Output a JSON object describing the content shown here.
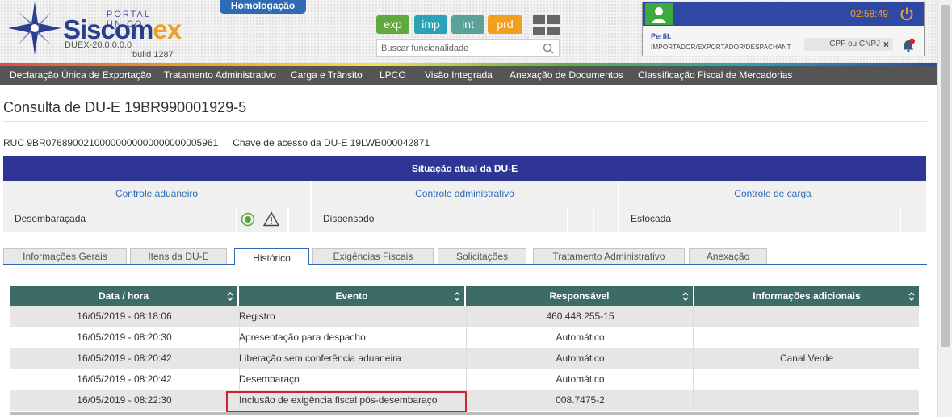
{
  "header": {
    "portal_label": "PORTAL ÚNICO",
    "brand_main": "Siscom",
    "brand_accent": "ex",
    "version": "DUEX-20.0.0.0.0",
    "build": "build 1287",
    "environment_badge": "Homologação",
    "modules": [
      "exp",
      "imp",
      "int",
      "prd"
    ],
    "search_placeholder": "Buscar funcionalidade",
    "clock": "02:58:49",
    "perfil_label": "Perfil:",
    "perfil_value": "IMPORTADOR/EXPORTADOR/DESPACHANT",
    "cpf_placeholder": "CPF ou CNPJ",
    "cpf_clear": "×",
    "icons": [
      "star-logo-icon",
      "apps-grid-icon",
      "search-icon",
      "user-avatar-icon",
      "power-icon",
      "bell-icon"
    ],
    "colors": {
      "brand_blue": "#2e49a3",
      "brand_orange": "#f0a020",
      "exp": "#61a83f",
      "imp": "#2aa3b8",
      "int": "#5aa19a",
      "prd": "#f0a01e"
    }
  },
  "nav": {
    "items": [
      "Declaração Única de Exportação",
      "Tratamento Administrativo",
      "Carga e Trânsito",
      "LPCO",
      "Visão Integrada",
      "Anexação de Documentos",
      "Classificação Fiscal de Mercadorias"
    ]
  },
  "page": {
    "title": "Consulta de DU-E 19BR990001929-5",
    "ruc": "RUC 9BR07689002100000000000000000005961",
    "chave": "Chave de acesso da DU-E 19LWB000042871"
  },
  "situacao": {
    "title": "Situação atual da DU-E",
    "controls": [
      "Controle aduaneiro",
      "Controle administrativo",
      "Controle de carga"
    ],
    "values": [
      "Desembaraçada",
      "Dispensado",
      "Estocada"
    ],
    "status_icons": [
      "check-circle-icon",
      "warning-icon"
    ]
  },
  "tabs": {
    "items": [
      "Informações Gerais",
      "Itens da DU-E",
      "Histórico",
      "Exigências Fiscais",
      "Solicitações",
      "Tratamento Administrativo",
      "Anexação"
    ],
    "active": "Histórico"
  },
  "table": {
    "columns": [
      "Data / hora",
      "Evento",
      "Responsável",
      "Informações adicionais"
    ],
    "rows": [
      [
        "16/05/2019 - 08:18:06",
        "Registro",
        "460.448.255-15",
        ""
      ],
      [
        "16/05/2019 - 08:20:30",
        "Apresentação para despacho",
        "Automático",
        ""
      ],
      [
        "16/05/2019 - 08:20:42",
        "Liberação sem conferência aduaneira",
        "Automático",
        "Canal Verde"
      ],
      [
        "16/05/2019 - 08:20:42",
        "Desembaraço",
        "Automático",
        ""
      ],
      [
        "16/05/2019 - 08:22:30",
        "Inclusão de exigência fiscal pós-desembaraço",
        "008.7475-2",
        ""
      ]
    ],
    "highlight_color": "#d9202a",
    "header_color": "#3d6b65"
  }
}
